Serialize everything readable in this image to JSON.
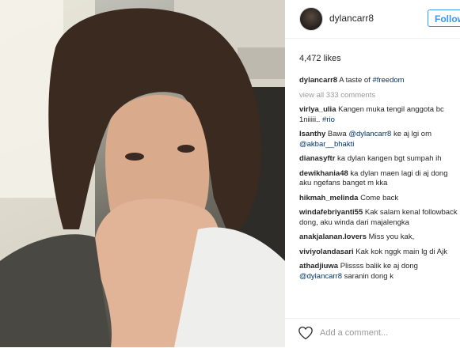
{
  "post": {
    "username": "dylancarr8",
    "follow_label": "Follow",
    "likes": "4,472 likes",
    "caption_text": "A taste of ",
    "caption_tag": "#freedom",
    "view_all": "view all 333 comments",
    "comment_placeholder": "Add a comment..."
  },
  "comments": [
    {
      "user": "virlya_ulia",
      "text": "Kangen muka tengil anggota bc 1niiiii.. ",
      "tag": "#rio"
    },
    {
      "user": "lsanthy",
      "text": "Bawa ",
      "tag": "@dylancarr8",
      "text2": " ke aj lgi om ",
      "tag2": "@akbar__bhakti"
    },
    {
      "user": "dianasyftr",
      "text": "ka dylan kangen bgt sumpah ih"
    },
    {
      "user": "dewikhania48",
      "text": "ka dylan maen lagi di aj dong aku ngefans banget m kka"
    },
    {
      "user": "hikmah_melinda",
      "text": "Come back"
    },
    {
      "user": "windafebriyanti55",
      "text": "Kak salam kenal followback dong, aku winda dari majalengka"
    },
    {
      "user": "anakjalanan.lovers",
      "text": "Miss you kak,"
    },
    {
      "user": "viviyolandasari",
      "text": "Kak kok nggk main lg di Ajk"
    },
    {
      "user": "athadjiuwa",
      "text": "Plissss balik ke aj dong ",
      "tag": "@dylancarr8",
      "text2": " saranin dong k"
    }
  ],
  "colors": {
    "accent": "#3897f0",
    "link": "#003569",
    "muted": "#999999"
  }
}
